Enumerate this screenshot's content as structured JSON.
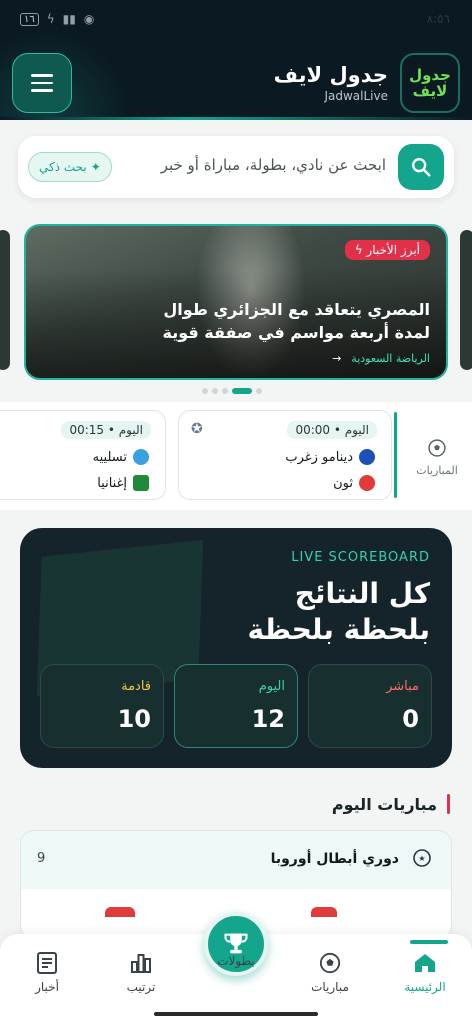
{
  "status_bar": {
    "time": "٨:٥٦",
    "battery": "١٦"
  },
  "header": {
    "title": "جدول لايف",
    "subtitle": "JadwalLive",
    "logo_text": "جدول لايف"
  },
  "search": {
    "placeholder": "ابحث عن نادي، بطولة، مباراة أو خبر",
    "smart_label": "بحث ذكي"
  },
  "news": {
    "tag": "أبرز الأخبار",
    "title": "المصري يتعاقد مع الجزائري طوال لمدة أربعة مواسم في صفقة قوية",
    "category": "الرياضة السعودية"
  },
  "matches_strip": {
    "label": "المباريات",
    "cards": [
      {
        "time": "اليوم • 00:00",
        "home": "دينامو زغرب",
        "away": "ثون"
      },
      {
        "time": "اليوم • 00:15",
        "home": "تسلييه",
        "away": "إغنانيا"
      }
    ]
  },
  "scoreboard": {
    "kicker": "LIVE SCOREBOARD",
    "title_line1": "كل النتائج",
    "title_line2": "بلحظة بلحظة",
    "stats": [
      {
        "label": "مباشر",
        "value": "0",
        "color": "#ff6b6b"
      },
      {
        "label": "اليوم",
        "value": "12",
        "color": "#36d0ae"
      },
      {
        "label": "قادمة",
        "value": "10",
        "color": "#f2c14e"
      }
    ]
  },
  "today": {
    "title": "مباريات اليوم",
    "league": {
      "name": "دوري أبطال أوروبا",
      "count": "9"
    }
  },
  "bottom_nav": {
    "home": "الرئيسية",
    "matches": "مباريات",
    "cups": "بطولات",
    "standings": "ترتيب",
    "news": "أخبار"
  },
  "colors": {
    "accent": "#14a58d",
    "header_bg": "#0b1a22",
    "tag_red": "#e2304b"
  }
}
